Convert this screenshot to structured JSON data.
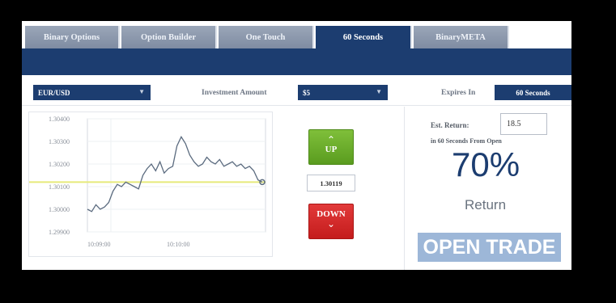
{
  "tabs": [
    {
      "label": "Binary Options",
      "active": false
    },
    {
      "label": "Option Builder",
      "active": false
    },
    {
      "label": "One Touch",
      "active": false
    },
    {
      "label": "60 Seconds",
      "active": true
    },
    {
      "label": "BinaryMETA",
      "active": false
    }
  ],
  "controls": {
    "asset_value": "EUR/USD",
    "investment_label": "Investment Amount",
    "investment_value": "$5",
    "expires_label": "Expires In",
    "expires_value": "60 Seconds"
  },
  "chart": {
    "y_ticks": [
      "1.30400",
      "1.30300",
      "1.30200",
      "1.30100",
      "1.30000",
      "1.29900"
    ],
    "x_ticks": [
      "10:09:00",
      "10:10:00"
    ]
  },
  "chart_data": {
    "type": "line",
    "title": "",
    "xlabel": "",
    "ylabel": "",
    "ylim": [
      1.299,
      1.304
    ],
    "x_ticks": [
      "10:09:00",
      "10:10:00"
    ],
    "series": [
      {
        "values": [
          1.3,
          1.2999,
          1.3002,
          1.3,
          1.3001,
          1.3003,
          1.3008,
          1.3011,
          1.301,
          1.3012,
          1.3011,
          1.301,
          1.3009,
          1.3015,
          1.3018,
          1.302,
          1.3017,
          1.3021,
          1.3016,
          1.3018,
          1.3019,
          1.3028,
          1.3032,
          1.3029,
          1.3024,
          1.3021,
          1.3019,
          1.302,
          1.3023,
          1.3021,
          1.302,
          1.3022,
          1.3019,
          1.302,
          1.3021,
          1.3019,
          1.302,
          1.3018,
          1.3019,
          1.3017,
          1.3013,
          1.3012
        ]
      }
    ],
    "reference_line": 1.3012,
    "grid": true,
    "colors": {
      "line": "#5b6b7f",
      "reference": "#e6ea7a"
    }
  },
  "trade": {
    "up_label": "UP",
    "down_label": "DOWN",
    "current_price": "1.30119"
  },
  "panel": {
    "est_return_label": "Est. Return:",
    "est_return_value": "18.5",
    "return_sub": "in 60 Seconds From Open",
    "return_pct": "70%",
    "return_label": "Return",
    "open_trade_label": "OPEN TRADE"
  },
  "colors": {
    "primary": "#1c3d70",
    "up": "#6aae2a",
    "down": "#d42828",
    "open_trade": "#9db7d8"
  }
}
